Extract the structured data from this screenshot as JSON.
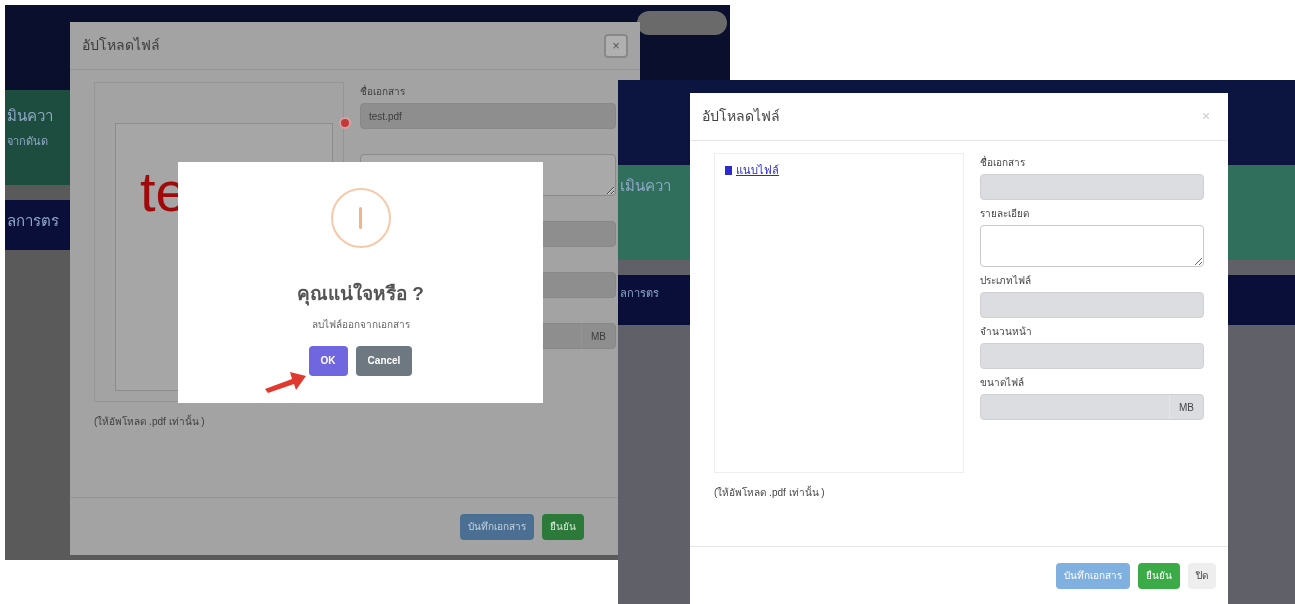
{
  "screenshots": [
    {
      "background_texts": [
        "มินควา",
        "จากดันด",
        "ลการตร"
      ],
      "modal": {
        "title": "อัปโหลดไฟล์",
        "close": "×",
        "preview_text": "te",
        "fields": [
          {
            "kind": "input",
            "label": "ชื่อเอกสาร",
            "value": "test.pdf"
          },
          {
            "kind": "textarea"
          },
          {
            "kind": "input"
          },
          {
            "kind": "input"
          },
          {
            "kind": "input_unit",
            "unit": "MB"
          }
        ],
        "hint": "(ให้อัพโหลด .pdf เท่านั้น )",
        "buttons": [
          {
            "label": "บันทึกเอกสาร",
            "kind": "primary"
          },
          {
            "label": "ยืนยัน",
            "kind": "success"
          }
        ]
      },
      "alert": {
        "title": "คุณแน่ใจหรือ ?",
        "message": "ลบไฟล์ออกจากเอกสาร",
        "buttons": [
          {
            "label": "OK",
            "kind": "confirm"
          },
          {
            "label": "Cancel",
            "kind": "cancel"
          }
        ]
      }
    },
    {
      "background_texts": [
        "เมินควา",
        "ลการตร"
      ],
      "modal": {
        "title": "อัปโหลดไฟล์",
        "close": "×",
        "attach_link": "แนบไฟล์",
        "fields": [
          {
            "kind": "input",
            "label": "ชื่อเอกสาร"
          },
          {
            "kind": "textarea",
            "label": "รายละเอียด"
          },
          {
            "kind": "input",
            "label": "ประเภทไฟล์"
          },
          {
            "kind": "input",
            "label": "จำนวนหน้า"
          },
          {
            "kind": "input_unit",
            "label": "ขนาดไฟล์",
            "unit": "MB"
          }
        ],
        "hint": "(ให้อัพโหลด .pdf เท่านั้น )",
        "buttons": [
          {
            "label": "บันทึกเอกสาร",
            "kind": "primary"
          },
          {
            "label": "ยืนยัน",
            "kind": "success"
          },
          {
            "label": "ปิด",
            "kind": "light"
          }
        ]
      }
    }
  ]
}
